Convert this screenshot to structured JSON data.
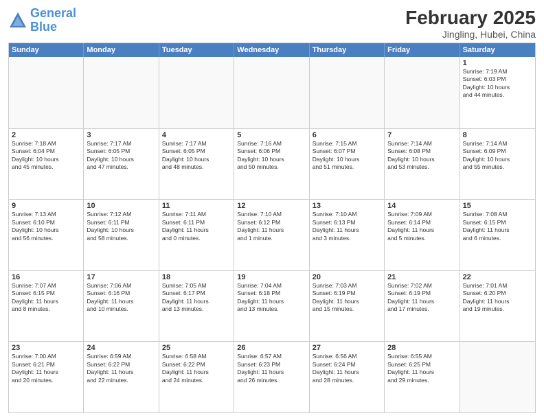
{
  "logo": {
    "line1": "General",
    "line2": "Blue"
  },
  "title": "February 2025",
  "subtitle": "Jingling, Hubei, China",
  "header_days": [
    "Sunday",
    "Monday",
    "Tuesday",
    "Wednesday",
    "Thursday",
    "Friday",
    "Saturday"
  ],
  "weeks": [
    [
      {
        "day": "",
        "info": ""
      },
      {
        "day": "",
        "info": ""
      },
      {
        "day": "",
        "info": ""
      },
      {
        "day": "",
        "info": ""
      },
      {
        "day": "",
        "info": ""
      },
      {
        "day": "",
        "info": ""
      },
      {
        "day": "1",
        "info": "Sunrise: 7:19 AM\nSunset: 6:03 PM\nDaylight: 10 hours\nand 44 minutes."
      }
    ],
    [
      {
        "day": "2",
        "info": "Sunrise: 7:18 AM\nSunset: 6:04 PM\nDaylight: 10 hours\nand 45 minutes."
      },
      {
        "day": "3",
        "info": "Sunrise: 7:17 AM\nSunset: 6:05 PM\nDaylight: 10 hours\nand 47 minutes."
      },
      {
        "day": "4",
        "info": "Sunrise: 7:17 AM\nSunset: 6:05 PM\nDaylight: 10 hours\nand 48 minutes."
      },
      {
        "day": "5",
        "info": "Sunrise: 7:16 AM\nSunset: 6:06 PM\nDaylight: 10 hours\nand 50 minutes."
      },
      {
        "day": "6",
        "info": "Sunrise: 7:15 AM\nSunset: 6:07 PM\nDaylight: 10 hours\nand 51 minutes."
      },
      {
        "day": "7",
        "info": "Sunrise: 7:14 AM\nSunset: 6:08 PM\nDaylight: 10 hours\nand 53 minutes."
      },
      {
        "day": "8",
        "info": "Sunrise: 7:14 AM\nSunset: 6:09 PM\nDaylight: 10 hours\nand 55 minutes."
      }
    ],
    [
      {
        "day": "9",
        "info": "Sunrise: 7:13 AM\nSunset: 6:10 PM\nDaylight: 10 hours\nand 56 minutes."
      },
      {
        "day": "10",
        "info": "Sunrise: 7:12 AM\nSunset: 6:11 PM\nDaylight: 10 hours\nand 58 minutes."
      },
      {
        "day": "11",
        "info": "Sunrise: 7:11 AM\nSunset: 6:11 PM\nDaylight: 11 hours\nand 0 minutes."
      },
      {
        "day": "12",
        "info": "Sunrise: 7:10 AM\nSunset: 6:12 PM\nDaylight: 11 hours\nand 1 minute."
      },
      {
        "day": "13",
        "info": "Sunrise: 7:10 AM\nSunset: 6:13 PM\nDaylight: 11 hours\nand 3 minutes."
      },
      {
        "day": "14",
        "info": "Sunrise: 7:09 AM\nSunset: 6:14 PM\nDaylight: 11 hours\nand 5 minutes."
      },
      {
        "day": "15",
        "info": "Sunrise: 7:08 AM\nSunset: 6:15 PM\nDaylight: 11 hours\nand 6 minutes."
      }
    ],
    [
      {
        "day": "16",
        "info": "Sunrise: 7:07 AM\nSunset: 6:15 PM\nDaylight: 11 hours\nand 8 minutes."
      },
      {
        "day": "17",
        "info": "Sunrise: 7:06 AM\nSunset: 6:16 PM\nDaylight: 11 hours\nand 10 minutes."
      },
      {
        "day": "18",
        "info": "Sunrise: 7:05 AM\nSunset: 6:17 PM\nDaylight: 11 hours\nand 13 minutes."
      },
      {
        "day": "19",
        "info": "Sunrise: 7:04 AM\nSunset: 6:18 PM\nDaylight: 11 hours\nand 13 minutes."
      },
      {
        "day": "20",
        "info": "Sunrise: 7:03 AM\nSunset: 6:19 PM\nDaylight: 11 hours\nand 15 minutes."
      },
      {
        "day": "21",
        "info": "Sunrise: 7:02 AM\nSunset: 6:19 PM\nDaylight: 11 hours\nand 17 minutes."
      },
      {
        "day": "22",
        "info": "Sunrise: 7:01 AM\nSunset: 6:20 PM\nDaylight: 11 hours\nand 19 minutes."
      }
    ],
    [
      {
        "day": "23",
        "info": "Sunrise: 7:00 AM\nSunset: 6:21 PM\nDaylight: 11 hours\nand 20 minutes."
      },
      {
        "day": "24",
        "info": "Sunrise: 6:59 AM\nSunset: 6:22 PM\nDaylight: 11 hours\nand 22 minutes."
      },
      {
        "day": "25",
        "info": "Sunrise: 6:58 AM\nSunset: 6:22 PM\nDaylight: 11 hours\nand 24 minutes."
      },
      {
        "day": "26",
        "info": "Sunrise: 6:57 AM\nSunset: 6:23 PM\nDaylight: 11 hours\nand 26 minutes."
      },
      {
        "day": "27",
        "info": "Sunrise: 6:56 AM\nSunset: 6:24 PM\nDaylight: 11 hours\nand 28 minutes."
      },
      {
        "day": "28",
        "info": "Sunrise: 6:55 AM\nSunset: 6:25 PM\nDaylight: 11 hours\nand 29 minutes."
      },
      {
        "day": "",
        "info": ""
      }
    ]
  ]
}
